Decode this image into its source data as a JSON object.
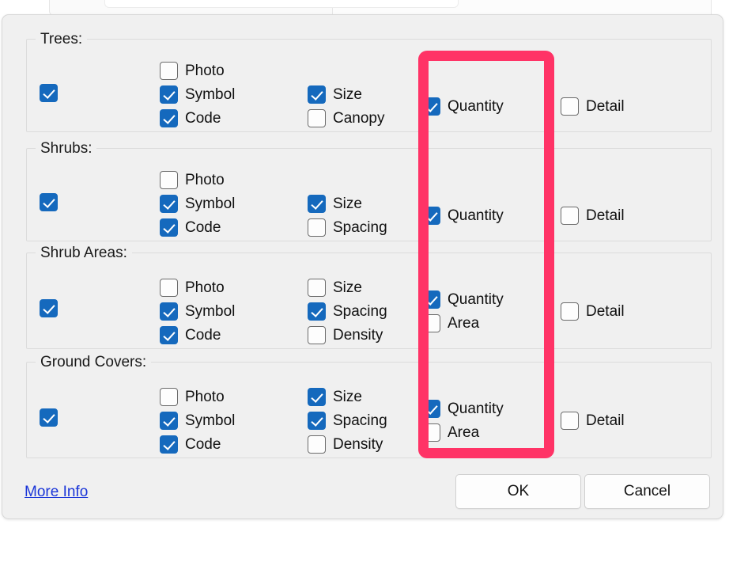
{
  "dialog": {
    "groups": [
      {
        "legend": "Trees:",
        "master": {
          "label": "",
          "checked": true
        },
        "col1": [
          {
            "label": "Photo",
            "checked": false
          },
          {
            "label": "Symbol",
            "checked": true
          },
          {
            "label": "Code",
            "checked": true
          }
        ],
        "col2": [
          {
            "label": "Size",
            "checked": true
          },
          {
            "label": "Canopy",
            "checked": false
          }
        ],
        "col3": [
          {
            "label": "Quantity",
            "checked": true
          }
        ],
        "col4": [
          {
            "label": "Detail",
            "checked": false
          }
        ]
      },
      {
        "legend": "Shrubs:",
        "master": {
          "label": "",
          "checked": true
        },
        "col1": [
          {
            "label": "Photo",
            "checked": false
          },
          {
            "label": "Symbol",
            "checked": true
          },
          {
            "label": "Code",
            "checked": true
          }
        ],
        "col2": [
          {
            "label": "Size",
            "checked": true
          },
          {
            "label": "Spacing",
            "checked": false
          }
        ],
        "col3": [
          {
            "label": "Quantity",
            "checked": true
          }
        ],
        "col4": [
          {
            "label": "Detail",
            "checked": false
          }
        ]
      },
      {
        "legend": "Shrub Areas:",
        "master": {
          "label": "",
          "checked": true
        },
        "col1": [
          {
            "label": "Photo",
            "checked": false
          },
          {
            "label": "Symbol",
            "checked": true
          },
          {
            "label": "Code",
            "checked": true
          }
        ],
        "col2": [
          {
            "label": "Size",
            "checked": false
          },
          {
            "label": "Spacing",
            "checked": true
          },
          {
            "label": "Density",
            "checked": false
          }
        ],
        "col3": [
          {
            "label": "Quantity",
            "checked": true
          },
          {
            "label": "Area",
            "checked": false
          }
        ],
        "col4": [
          {
            "label": "Detail",
            "checked": false
          }
        ]
      },
      {
        "legend": "Ground Covers:",
        "master": {
          "label": "",
          "checked": true
        },
        "col1": [
          {
            "label": "Photo",
            "checked": false
          },
          {
            "label": "Symbol",
            "checked": true
          },
          {
            "label": "Code",
            "checked": true
          }
        ],
        "col2": [
          {
            "label": "Size",
            "checked": true
          },
          {
            "label": "Spacing",
            "checked": true
          },
          {
            "label": "Density",
            "checked": false
          }
        ],
        "col3": [
          {
            "label": "Quantity",
            "checked": true
          },
          {
            "label": "Area",
            "checked": false
          }
        ],
        "col4": [
          {
            "label": "Detail",
            "checked": false
          }
        ]
      }
    ],
    "footer": {
      "more_info_label": "More Info",
      "ok_label": "OK",
      "cancel_label": "Cancel"
    }
  },
  "annotation": {
    "highlight_color": "#ff3366",
    "target_column": "Quantity"
  },
  "colors": {
    "checkbox_checked": "#1569bd",
    "checkbox_border": "#6b6b6b",
    "dialog_background": "#f0f0f0",
    "link": "#1a35d8"
  }
}
